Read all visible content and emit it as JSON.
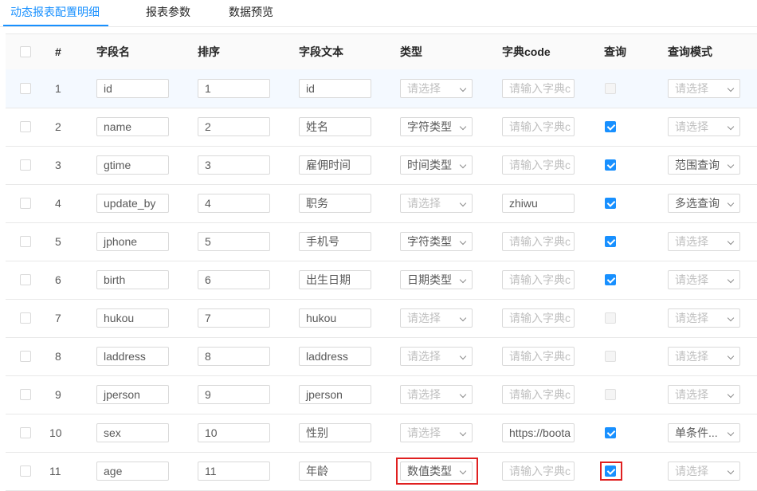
{
  "tabs": [
    {
      "label": "动态报表配置明细",
      "active": true
    },
    {
      "label": "报表参数",
      "active": false
    },
    {
      "label": "数据预览",
      "active": false
    }
  ],
  "columns": [
    "#",
    "字段名",
    "排序",
    "字段文本",
    "类型",
    "字典code",
    "查询",
    "查询模式"
  ],
  "placeholders": {
    "select": "请选择",
    "dict": "请输入字典c"
  },
  "rows": [
    {
      "index": "1",
      "field": "id",
      "order": "1",
      "text": "id",
      "type": "",
      "dict": "",
      "query": "disabled",
      "mode": ""
    },
    {
      "index": "2",
      "field": "name",
      "order": "2",
      "text": "姓名",
      "type": "字符类型",
      "dict": "",
      "query": "checked",
      "mode": ""
    },
    {
      "index": "3",
      "field": "gtime",
      "order": "3",
      "text": "雇佣时间",
      "type": "时间类型",
      "dict": "",
      "query": "checked",
      "mode": "范围查询"
    },
    {
      "index": "4",
      "field": "update_by",
      "order": "4",
      "text": "职务",
      "type": "",
      "dict": "zhiwu",
      "query": "checked",
      "mode": "多选查询"
    },
    {
      "index": "5",
      "field": "jphone",
      "order": "5",
      "text": "手机号",
      "type": "字符类型",
      "dict": "",
      "query": "checked",
      "mode": ""
    },
    {
      "index": "6",
      "field": "birth",
      "order": "6",
      "text": "出生日期",
      "type": "日期类型",
      "dict": "",
      "query": "checked",
      "mode": ""
    },
    {
      "index": "7",
      "field": "hukou",
      "order": "7",
      "text": "hukou",
      "type": "",
      "dict": "",
      "query": "disabled",
      "mode": ""
    },
    {
      "index": "8",
      "field": "laddress",
      "order": "8",
      "text": "laddress",
      "type": "",
      "dict": "",
      "query": "disabled",
      "mode": ""
    },
    {
      "index": "9",
      "field": "jperson",
      "order": "9",
      "text": "jperson",
      "type": "",
      "dict": "",
      "query": "disabled",
      "mode": ""
    },
    {
      "index": "10",
      "field": "sex",
      "order": "10",
      "text": "性别",
      "type": "",
      "dict": "https://boota",
      "query": "checked",
      "mode": "单条件..."
    },
    {
      "index": "11",
      "field": "age",
      "order": "11",
      "text": "年龄",
      "type": "数值类型",
      "dict": "",
      "query": "checked",
      "mode": ""
    }
  ],
  "highlight_row_index": 0,
  "annotations": {
    "red_box_color": "#e02020",
    "boxed_row": "11",
    "boxed_fields": [
      "type",
      "query"
    ]
  },
  "colors": {
    "accent": "#1890ff",
    "checkbox_checked": "#1890ff",
    "placeholder": "#bfbfbf",
    "row_highlight": "#f4f9ff"
  },
  "icons": {
    "select_arrow": "chevron-down-icon",
    "check": "check-icon"
  }
}
